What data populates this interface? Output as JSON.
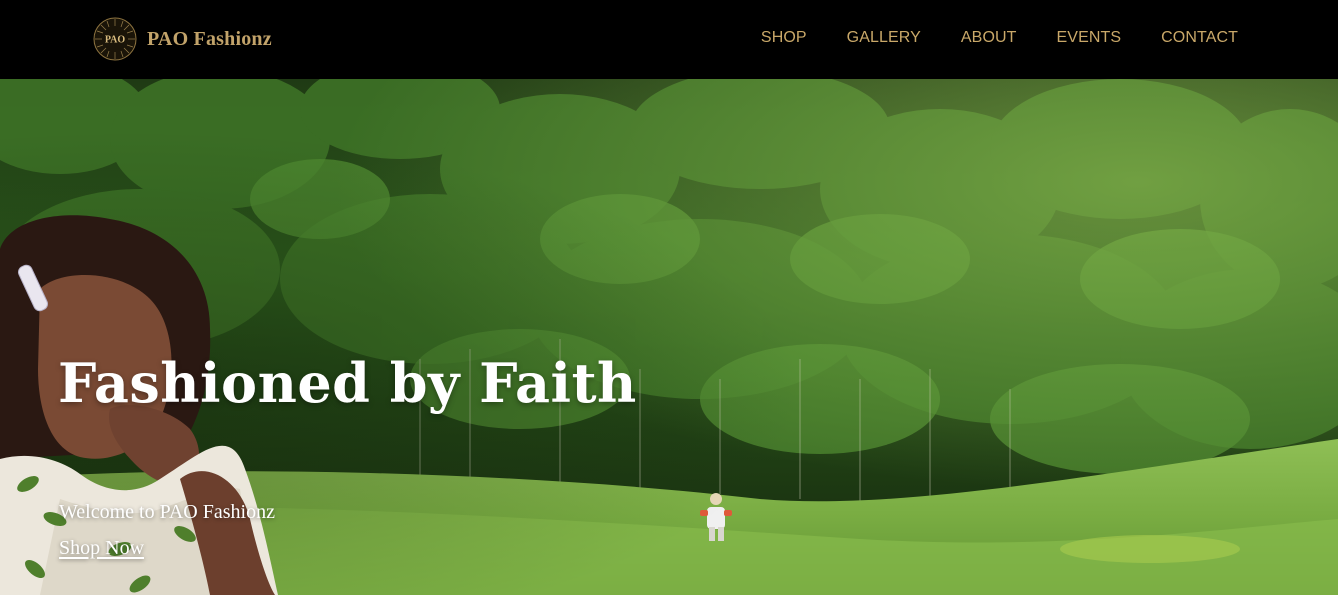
{
  "header": {
    "brand_name": "PAO Fashionz",
    "logo_text": "PAO",
    "nav": [
      {
        "label": "SHOP"
      },
      {
        "label": "GALLERY"
      },
      {
        "label": "ABOUT"
      },
      {
        "label": "EVENTS"
      },
      {
        "label": "CONTACT"
      }
    ]
  },
  "hero": {
    "title": "Fashioned by Faith",
    "subtitle": "Welcome to PAO Fashionz",
    "cta_label": "Shop Now"
  },
  "colors": {
    "header_bg": "#000000",
    "brand_gold": "#c2a36a",
    "nav_gold": "#c9a869",
    "hero_text": "#ffffff"
  }
}
